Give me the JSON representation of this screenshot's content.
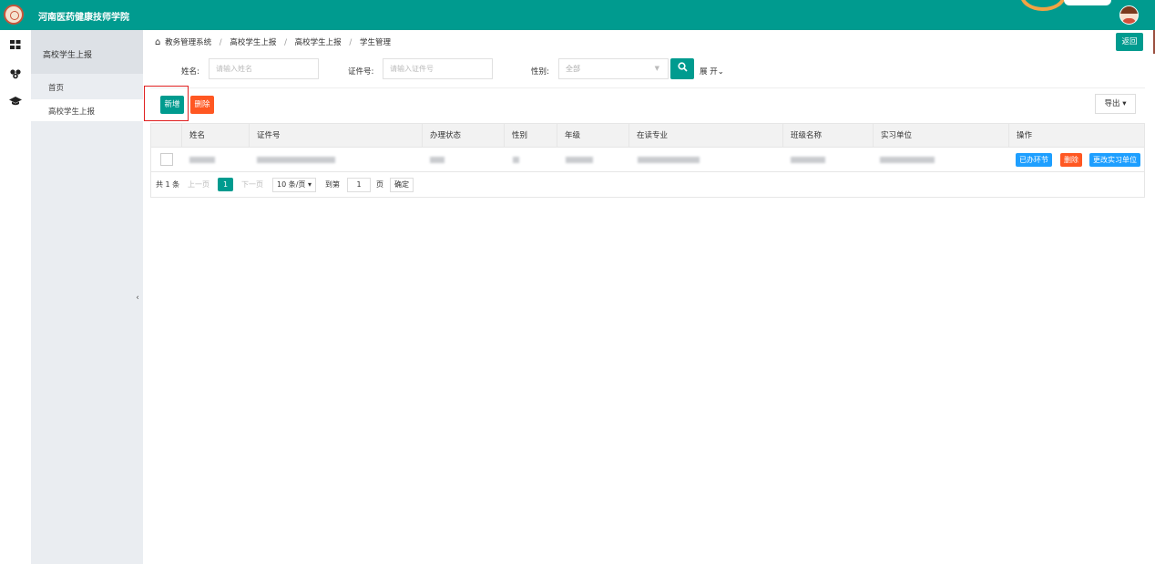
{
  "header": {
    "app_title": "河南医药健康技师学院"
  },
  "sidebar": {
    "section_title": "高校学生上报",
    "items": [
      {
        "label": "首页"
      },
      {
        "label": "高校学生上报"
      }
    ]
  },
  "breadcrumb": {
    "items": [
      "教务管理系统",
      "高校学生上报",
      "高校学生上报",
      "学生管理"
    ],
    "separator": "/"
  },
  "back_button": "返回",
  "search": {
    "name_label": "姓名:",
    "name_placeholder": "请输入姓名",
    "id_label": "证件号:",
    "id_placeholder": "请输入证件号",
    "gender_label": "性别:",
    "gender_value": "全部",
    "expand_label": "展 开⌄"
  },
  "toolbar": {
    "add_label": "新增",
    "delete_label": "删除",
    "export_label": "导出 ▾"
  },
  "table": {
    "columns": [
      "姓名",
      "证件号",
      "办理状态",
      "性别",
      "年级",
      "在读专业",
      "班级名称",
      "实习单位",
      "操作"
    ],
    "row_actions": [
      "已办环节",
      "删除",
      "更改实习单位"
    ]
  },
  "pager": {
    "total": "共 1 条",
    "prev": "上一页",
    "current_page": "1",
    "next": "下一页",
    "page_size": "10 条/页 ▾",
    "goto_label": "到第",
    "goto_value": "1",
    "page_suffix": "页",
    "confirm": "确定"
  },
  "colors": {
    "brand": "#009b8f",
    "danger": "#ff5722",
    "info": "#1e9fff"
  },
  "icons": [
    "logo",
    "grid-icon",
    "users-icon",
    "graduation-cap-icon",
    "home-icon",
    "search-icon",
    "avatar"
  ]
}
